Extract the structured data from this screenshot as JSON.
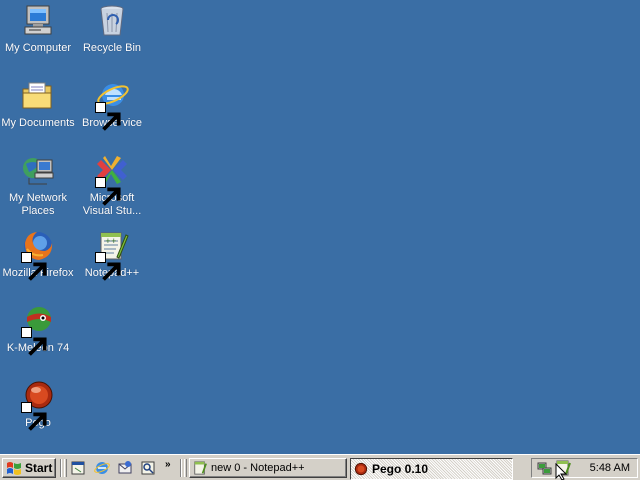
{
  "desktop": {
    "background": "#3a6ea5",
    "icons": [
      {
        "label": "My Computer",
        "icon": "computer-icon"
      },
      {
        "label": "Recycle Bin",
        "icon": "recycle-bin-icon"
      },
      {
        "label": "My Documents",
        "icon": "folder-icon"
      },
      {
        "label": "Browservice",
        "icon": "internet-explorer-icon"
      },
      {
        "label": "My Network\nPlaces",
        "icon": "network-places-icon"
      },
      {
        "label": "Microsoft\nVisual Stu...",
        "icon": "visual-studio-icon"
      },
      {
        "label": "Mozilla Firefox",
        "icon": "firefox-icon"
      },
      {
        "label": "Notepad++",
        "icon": "notepad-plus-plus-icon"
      },
      {
        "label": "K-Meleon 74",
        "icon": "k-meleon-icon"
      },
      {
        "label": "Pego",
        "icon": "pego-icon"
      }
    ]
  },
  "taskbar": {
    "start_label": "Start",
    "quick_launch": [
      "show-desktop-icon",
      "internet-explorer-icon",
      "outlook-express-icon",
      "media-icon"
    ],
    "quick_launch_more": "»",
    "tasks": [
      {
        "label": "new  0 - Notepad++",
        "icon": "notepad-plus-plus-icon",
        "active": false
      },
      {
        "label": "Pego 0.10",
        "icon": "pego-icon",
        "active": true
      }
    ],
    "tray_icons": [
      "network-tray-icon",
      "notepad-tray-icon"
    ],
    "clock": "5:48 AM"
  }
}
